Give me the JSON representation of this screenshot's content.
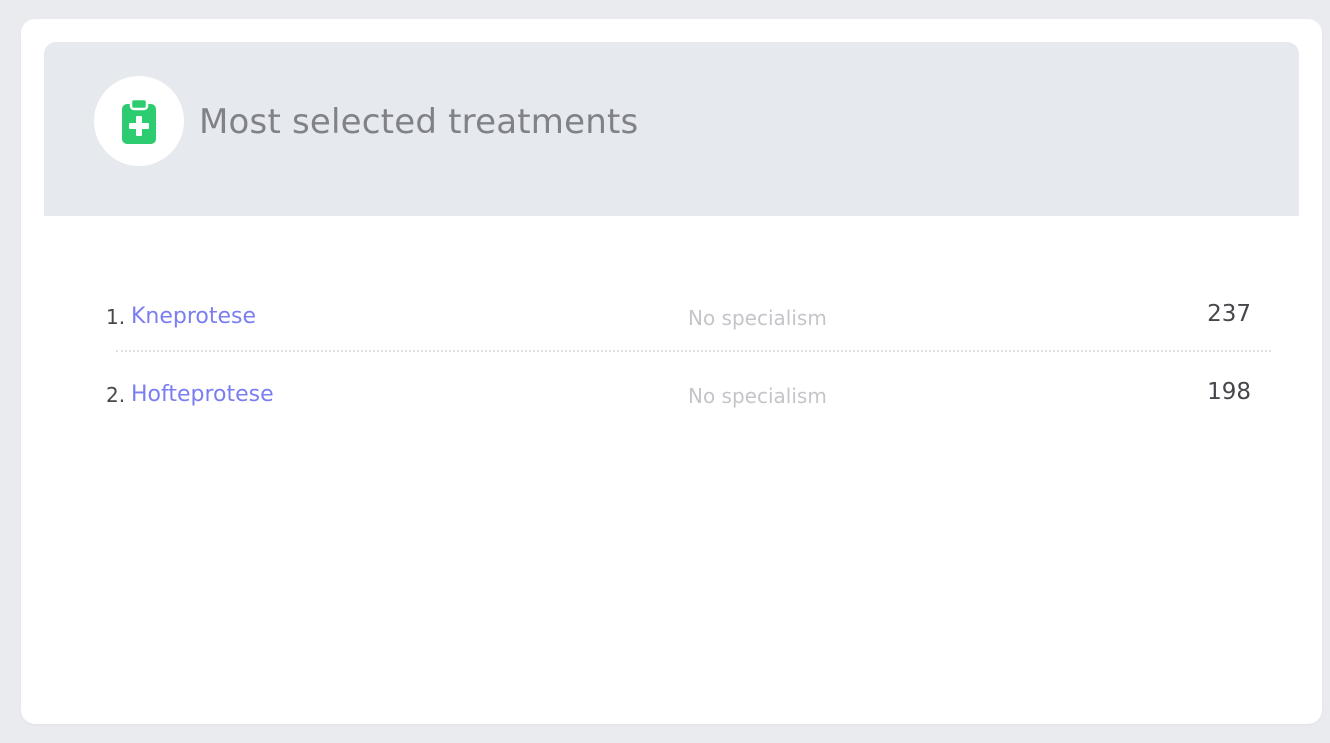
{
  "widget": {
    "title": "Most selected treatments",
    "icon": "clipboard-medical-icon",
    "accent_color": "#2ecc71",
    "link_color": "#7b7ef0"
  },
  "treatments": [
    {
      "rank": "1.",
      "name": "Kneprotese",
      "specialism": "No specialism",
      "count": "237"
    },
    {
      "rank": "2.",
      "name": "Hofteprotese",
      "specialism": "No specialism",
      "count": "198"
    }
  ]
}
